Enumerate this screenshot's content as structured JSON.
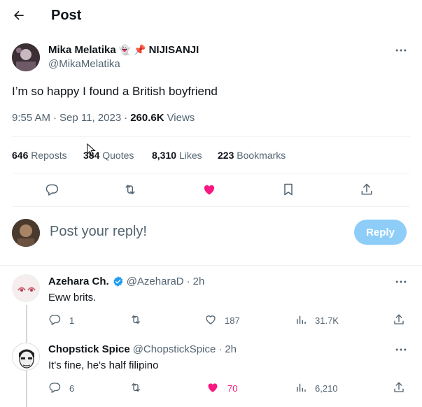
{
  "header": {
    "title": "Post"
  },
  "post": {
    "author_name": "Mika Melatika",
    "author_badge_text": "NIJISANJI",
    "handle": "@MikaMelatika",
    "text": "I’m so happy I found a British boyfriend",
    "time": "9:55 AM",
    "date": "Sep 11, 2023",
    "views_count": "260.6K",
    "views_label": "Views",
    "stats": {
      "reposts_count": "646",
      "reposts_label": "Reposts",
      "quotes_count": "384",
      "quotes_label": "Quotes",
      "likes_count": "8,310",
      "likes_label": "Likes",
      "bookmarks_count": "223",
      "bookmarks_label": "Bookmarks"
    }
  },
  "composer": {
    "placeholder": "Post your reply!",
    "button_label": "Reply"
  },
  "replies": [
    {
      "name": "Azehara Ch.",
      "handle": "@AzeharaD",
      "time": "2h",
      "text": "Eww brits.",
      "replies_count": "1",
      "retweets_count": "",
      "likes_count": "187",
      "views_count": "31.7K"
    },
    {
      "name": "Chopstick Spice",
      "handle": "@ChopstickSpice",
      "time": "2h",
      "text": "It's fine, he's half filipino",
      "replies_count": "6",
      "retweets_count": "",
      "likes_count": "70",
      "views_count": "6,210"
    }
  ],
  "colors": {
    "like_active": "#f91880",
    "verified": "#1d9bf0",
    "reply_button": "#8ecdf8"
  }
}
